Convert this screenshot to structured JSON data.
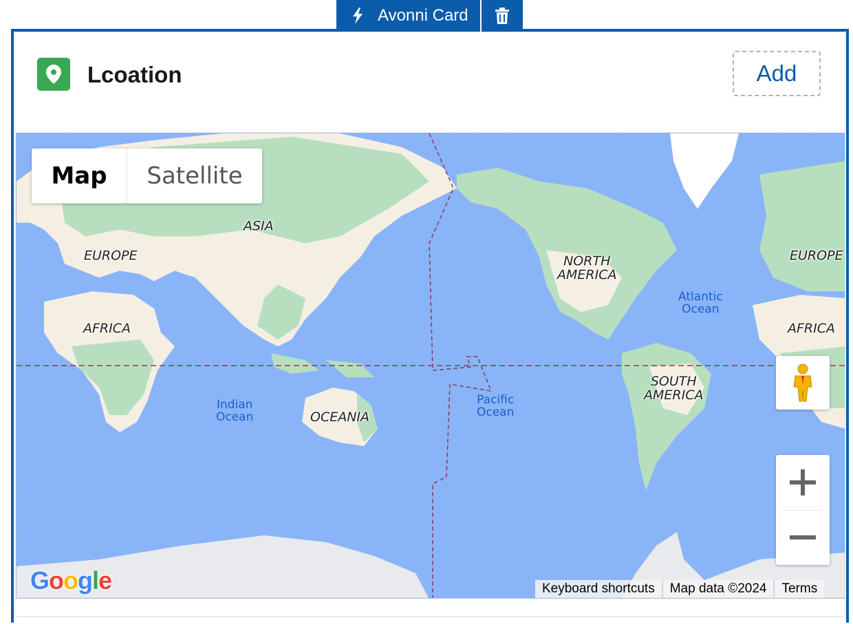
{
  "builder": {
    "card_label": "Avonni Card",
    "delete_icon": "trash-icon",
    "bolt_icon": "lightning-bolt-icon"
  },
  "card": {
    "title": "Lcoation",
    "icon": "location-pin-icon",
    "icon_color": "#3ba755",
    "add_label": "Add"
  },
  "map": {
    "type_controls": {
      "map_label": "Map",
      "satellite_label": "Satellite",
      "selected": "Map"
    },
    "labels": {
      "asia": "ASIA",
      "europe_left": "EUROPE",
      "europe_right": "EUROPE",
      "africa_left": "AFRICA",
      "africa_right": "AFRICA",
      "north_america": "NORTH\nAMERICA",
      "south_america": "SOUTH\nAMERICA",
      "oceania": "OCEANIA",
      "indian_ocean": "Indian\nOcean",
      "pacific_ocean": "Pacific\nOcean",
      "atlantic_ocean": "Atlantic\nOcean"
    },
    "logo": "Google",
    "attribution": {
      "shortcuts": "Keyboard shortcuts",
      "data": "Map data ©2024",
      "terms": "Terms"
    },
    "zoom": {
      "in_icon": "plus-icon",
      "out_icon": "minus-icon"
    },
    "street_view_icon": "pegman-icon",
    "colors": {
      "water": "#8ab4f8",
      "land": "#f5efe3",
      "vegetation": "#b7dfbf",
      "ice": "#e8eaed",
      "accent": "#0b5cab"
    }
  }
}
